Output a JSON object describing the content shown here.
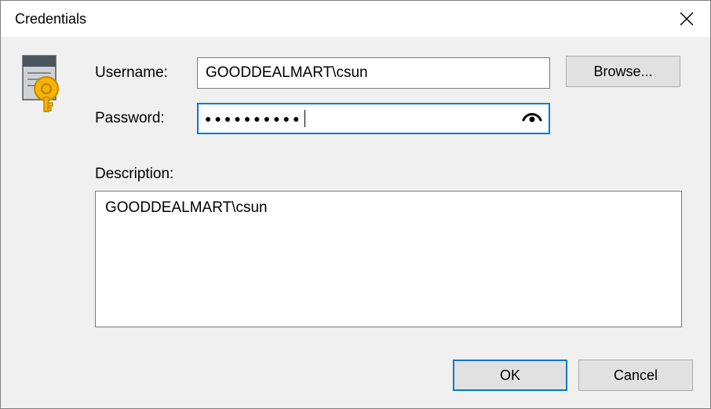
{
  "dialog": {
    "title": "Credentials"
  },
  "labels": {
    "username": "Username:",
    "password": "Password:",
    "description": "Description:"
  },
  "fields": {
    "username": "GOODDEALMART\\csun",
    "password_mask": "●●●●●●●●●●",
    "description": "GOODDEALMART\\csun"
  },
  "buttons": {
    "browse": "Browse...",
    "ok": "OK",
    "cancel": "Cancel"
  }
}
